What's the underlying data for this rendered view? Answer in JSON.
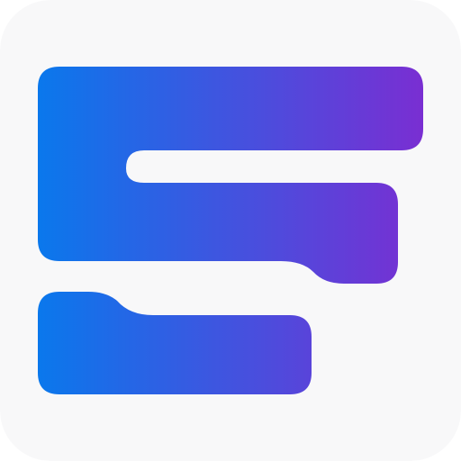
{
  "app_icon": {
    "icon_name": "app-logo-icon",
    "background_color": "#F8F8F9",
    "gradient": {
      "start_color": "#0A78EC",
      "end_color": "#7A2ED2"
    }
  }
}
